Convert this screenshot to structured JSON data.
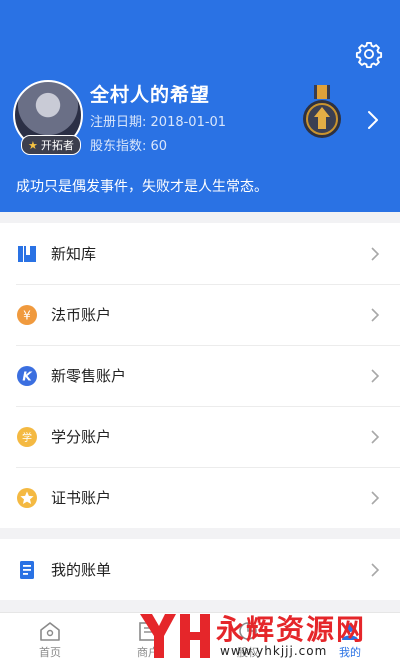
{
  "profile": {
    "username": "全村人的希望",
    "badge": "开拓者",
    "reg_label": "注册日期:",
    "reg_date": "2018-01-01",
    "shareholder_label": "股东指数:",
    "shareholder_value": "60",
    "motto": "成功只是偶发事件，失败才是人生常态。"
  },
  "menu": {
    "items": [
      {
        "label": "新知库",
        "icon": "book-icon"
      },
      {
        "label": "法币账户",
        "icon": "yen-icon"
      },
      {
        "label": "新零售账户",
        "icon": "k-coin-icon"
      },
      {
        "label": "学分账户",
        "icon": "credit-icon"
      },
      {
        "label": "证书账户",
        "icon": "star-coin-icon"
      }
    ],
    "bill": {
      "label": "我的账单",
      "icon": "bill-icon"
    }
  },
  "tabs": [
    {
      "label": "首页",
      "icon": "home-icon"
    },
    {
      "label": "商户",
      "icon": "merchant-icon"
    },
    {
      "label": "股权",
      "icon": "equity-icon"
    },
    {
      "label": "",
      "icon": "tab4-icon"
    },
    {
      "label": "我的",
      "icon": "me-icon",
      "active": true
    }
  ],
  "watermark": {
    "main": "永辉资源网",
    "url": "www.yhkjjj.com",
    "logo": "YH"
  },
  "colors": {
    "header_blue": "#2a72e4",
    "orange": "#f09a3e",
    "gold": "#f4b942",
    "watermark_red": "#e5262a"
  }
}
